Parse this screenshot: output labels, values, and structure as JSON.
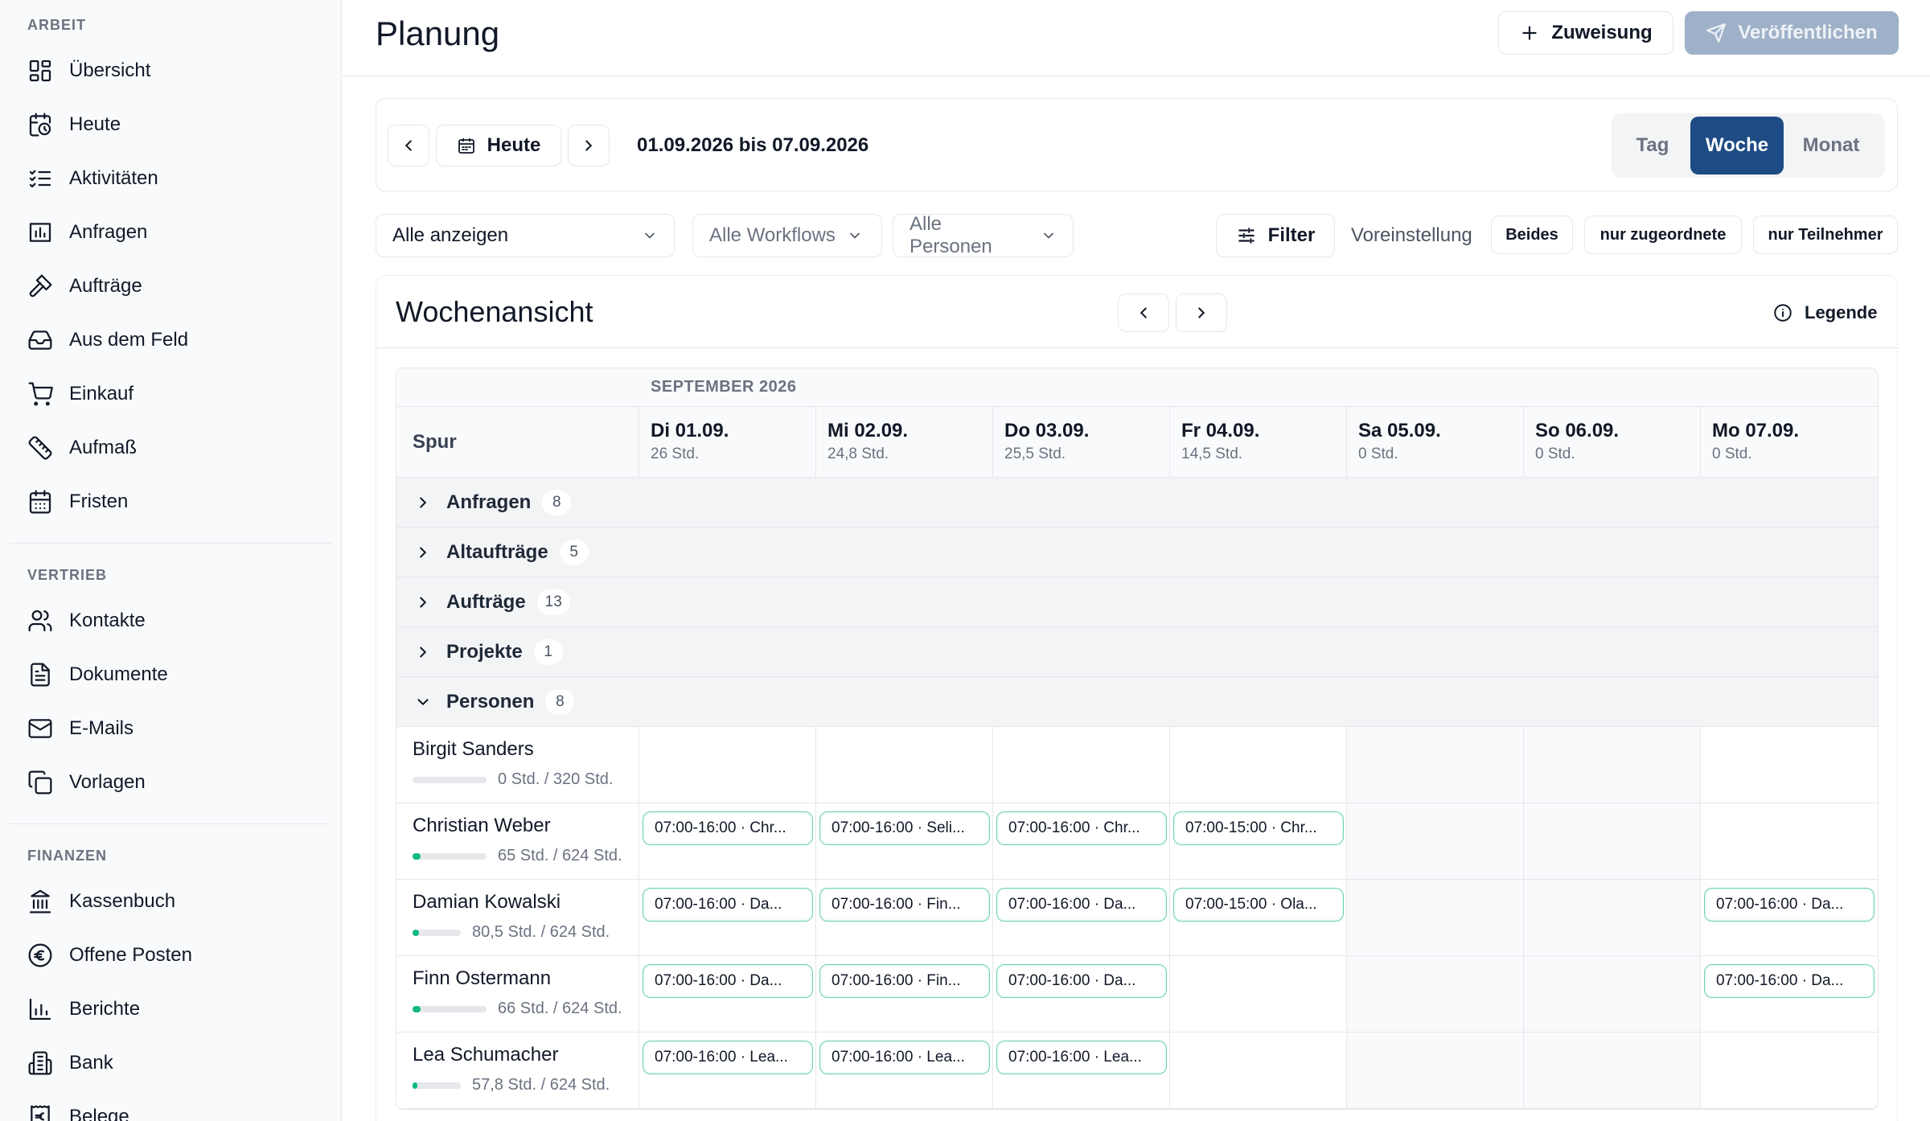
{
  "sidebar": {
    "sections": [
      {
        "title": "ARBEIT",
        "items": [
          {
            "label": "Übersicht",
            "icon": "dashboard-icon"
          },
          {
            "label": "Heute",
            "icon": "calendar-clock-icon"
          },
          {
            "label": "Aktivitäten",
            "icon": "checklist-icon"
          },
          {
            "label": "Anfragen",
            "icon": "inbox-chart-icon"
          },
          {
            "label": "Aufträge",
            "icon": "hammer-icon"
          },
          {
            "label": "Aus dem Feld",
            "icon": "tray-icon"
          },
          {
            "label": "Einkauf",
            "icon": "cart-icon"
          },
          {
            "label": "Aufmaß",
            "icon": "ruler-icon"
          },
          {
            "label": "Fristen",
            "icon": "calendar-icon"
          }
        ]
      },
      {
        "title": "VERTRIEB",
        "items": [
          {
            "label": "Kontakte",
            "icon": "users-icon"
          },
          {
            "label": "Dokumente",
            "icon": "document-icon"
          },
          {
            "label": "E-Mails",
            "icon": "mail-icon"
          },
          {
            "label": "Vorlagen",
            "icon": "copy-icon"
          }
        ]
      },
      {
        "title": "FINANZEN",
        "items": [
          {
            "label": "Kassenbuch",
            "icon": "bank-icon"
          },
          {
            "label": "Offene Posten",
            "icon": "euro-circle-icon"
          },
          {
            "label": "Berichte",
            "icon": "bar-chart-icon"
          },
          {
            "label": "Bank",
            "icon": "building-icon"
          },
          {
            "label": "Belege",
            "icon": "euro-receipt-icon"
          }
        ]
      }
    ]
  },
  "header": {
    "title": "Planung",
    "assign_label": "Zuweisung",
    "publish_label": "Veröffentlichen"
  },
  "datebar": {
    "today_label": "Heute",
    "range": "01.09.2026 bis 07.09.2026",
    "views": [
      {
        "label": "Tag",
        "active": false
      },
      {
        "label": "Woche",
        "active": true
      },
      {
        "label": "Monat",
        "active": false
      }
    ]
  },
  "filters": {
    "show": "Alle anzeigen",
    "workflows": "Alle Workflows",
    "persons": "Alle Personen",
    "filter_label": "Filter",
    "preset_label": "Voreinstellung",
    "presets": [
      "Beides",
      "nur zugeordnete",
      "nur Teilnehmer"
    ]
  },
  "week": {
    "title": "Wochenansicht",
    "legend_label": "Legende",
    "month": "SEPTEMBER 2026",
    "lane_header": "Spur",
    "days": [
      {
        "name": "Di 01.09.",
        "hours": "26 Std.",
        "weekend": false
      },
      {
        "name": "Mi 02.09.",
        "hours": "24,8 Std.",
        "weekend": false
      },
      {
        "name": "Do 03.09.",
        "hours": "25,5 Std.",
        "weekend": false
      },
      {
        "name": "Fr 04.09.",
        "hours": "14,5 Std.",
        "weekend": false
      },
      {
        "name": "Sa 05.09.",
        "hours": "0 Std.",
        "weekend": true
      },
      {
        "name": "So 06.09.",
        "hours": "0 Std.",
        "weekend": true
      },
      {
        "name": "Mo 07.09.",
        "hours": "0 Std.",
        "weekend": false
      }
    ],
    "groups": [
      {
        "label": "Anfragen",
        "count": "8",
        "expanded": false
      },
      {
        "label": "Altaufträge",
        "count": "5",
        "expanded": false
      },
      {
        "label": "Aufträge",
        "count": "13",
        "expanded": false
      },
      {
        "label": "Projekte",
        "count": "1",
        "expanded": false
      },
      {
        "label": "Personen",
        "count": "8",
        "expanded": true
      }
    ],
    "persons": [
      {
        "name": "Birgit Sanders",
        "hours": "0 Std. / 320 Std.",
        "progress": 0,
        "shifts": [
          "",
          "",
          "",
          "",
          "",
          "",
          ""
        ]
      },
      {
        "name": "Christian Weber",
        "hours": "65 Std. / 624 Std.",
        "progress": 0.104,
        "shifts": [
          "07:00-16:00 · Chr...",
          "07:00-16:00 · Seli...",
          "07:00-16:00 · Chr...",
          "07:00-15:00 · Chr...",
          "",
          "",
          ""
        ]
      },
      {
        "name": "Damian Kowalski",
        "hours": "80,5 Std. / 624 Std.",
        "progress": 0.129,
        "shifts": [
          "07:00-16:00 · Da...",
          "07:00-16:00 · Fin...",
          "07:00-16:00 · Da...",
          "07:00-15:00 · Ola...",
          "",
          "",
          "07:00-16:00 · Da..."
        ]
      },
      {
        "name": "Finn Ostermann",
        "hours": "66 Std. / 624 Std.",
        "progress": 0.106,
        "shifts": [
          "07:00-16:00 · Da...",
          "07:00-16:00 · Fin...",
          "07:00-16:00 · Da...",
          "",
          "",
          "",
          "07:00-16:00 · Da..."
        ]
      },
      {
        "name": "Lea Schumacher",
        "hours": "57,8 Std. / 624 Std.",
        "progress": 0.093,
        "shifts": [
          "07:00-16:00 · Lea...",
          "07:00-16:00 · Lea...",
          "07:00-16:00 · Lea...",
          "",
          "",
          "",
          ""
        ]
      }
    ]
  },
  "colors": {
    "accent": "#1e4a85",
    "publish_disabled": "#9fb1c8",
    "shift_border": "#6fcfa9",
    "progress": "#10b981"
  }
}
